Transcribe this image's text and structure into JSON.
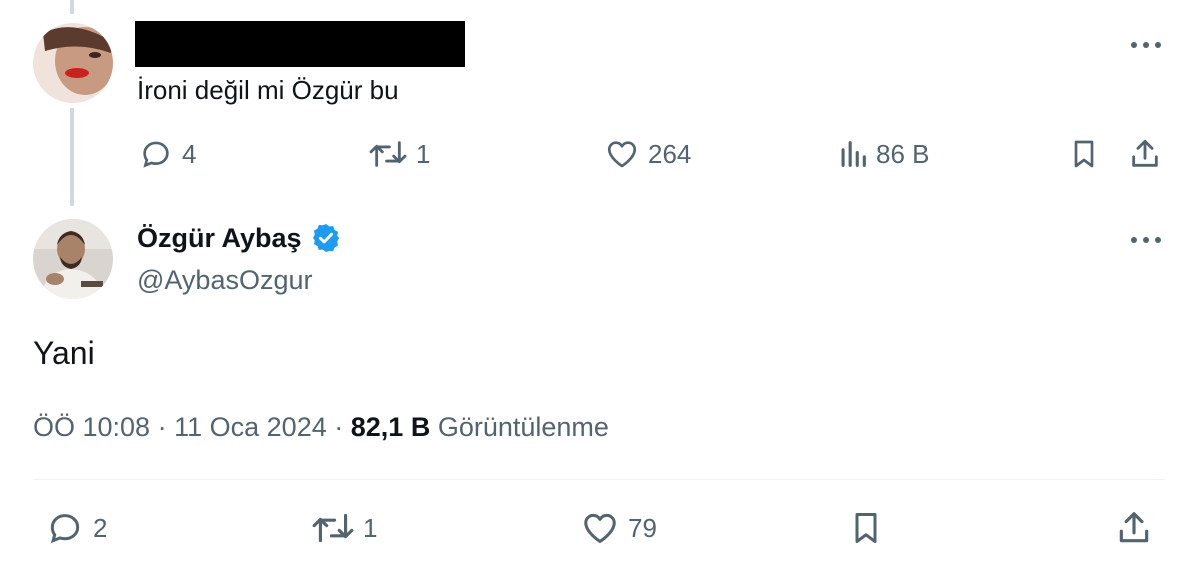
{
  "reply_tweet": {
    "text": "İroni değil mi Özgür bu",
    "more_icon": "more-dots-icon",
    "actions": {
      "replies": "4",
      "retweets": "1",
      "likes": "264",
      "views": "86 B"
    }
  },
  "main_tweet": {
    "author_name": "Özgür Aybaş",
    "author_handle": "@AybasOzgur",
    "verified_icon": "verified-badge-icon",
    "text": "Yani",
    "time": "ÖÖ 10:08",
    "date": "11 Oca 2024",
    "separator": "·",
    "view_count": "82,1 B",
    "view_label": "Görüntülenme",
    "actions": {
      "replies": "2",
      "retweets": "1",
      "likes": "79"
    }
  },
  "colors": {
    "text": "#0f1419",
    "secondary": "#536471",
    "verified": "#1d9bf0",
    "thread_line": "#cfd9de",
    "divider": "#eff3f4"
  }
}
